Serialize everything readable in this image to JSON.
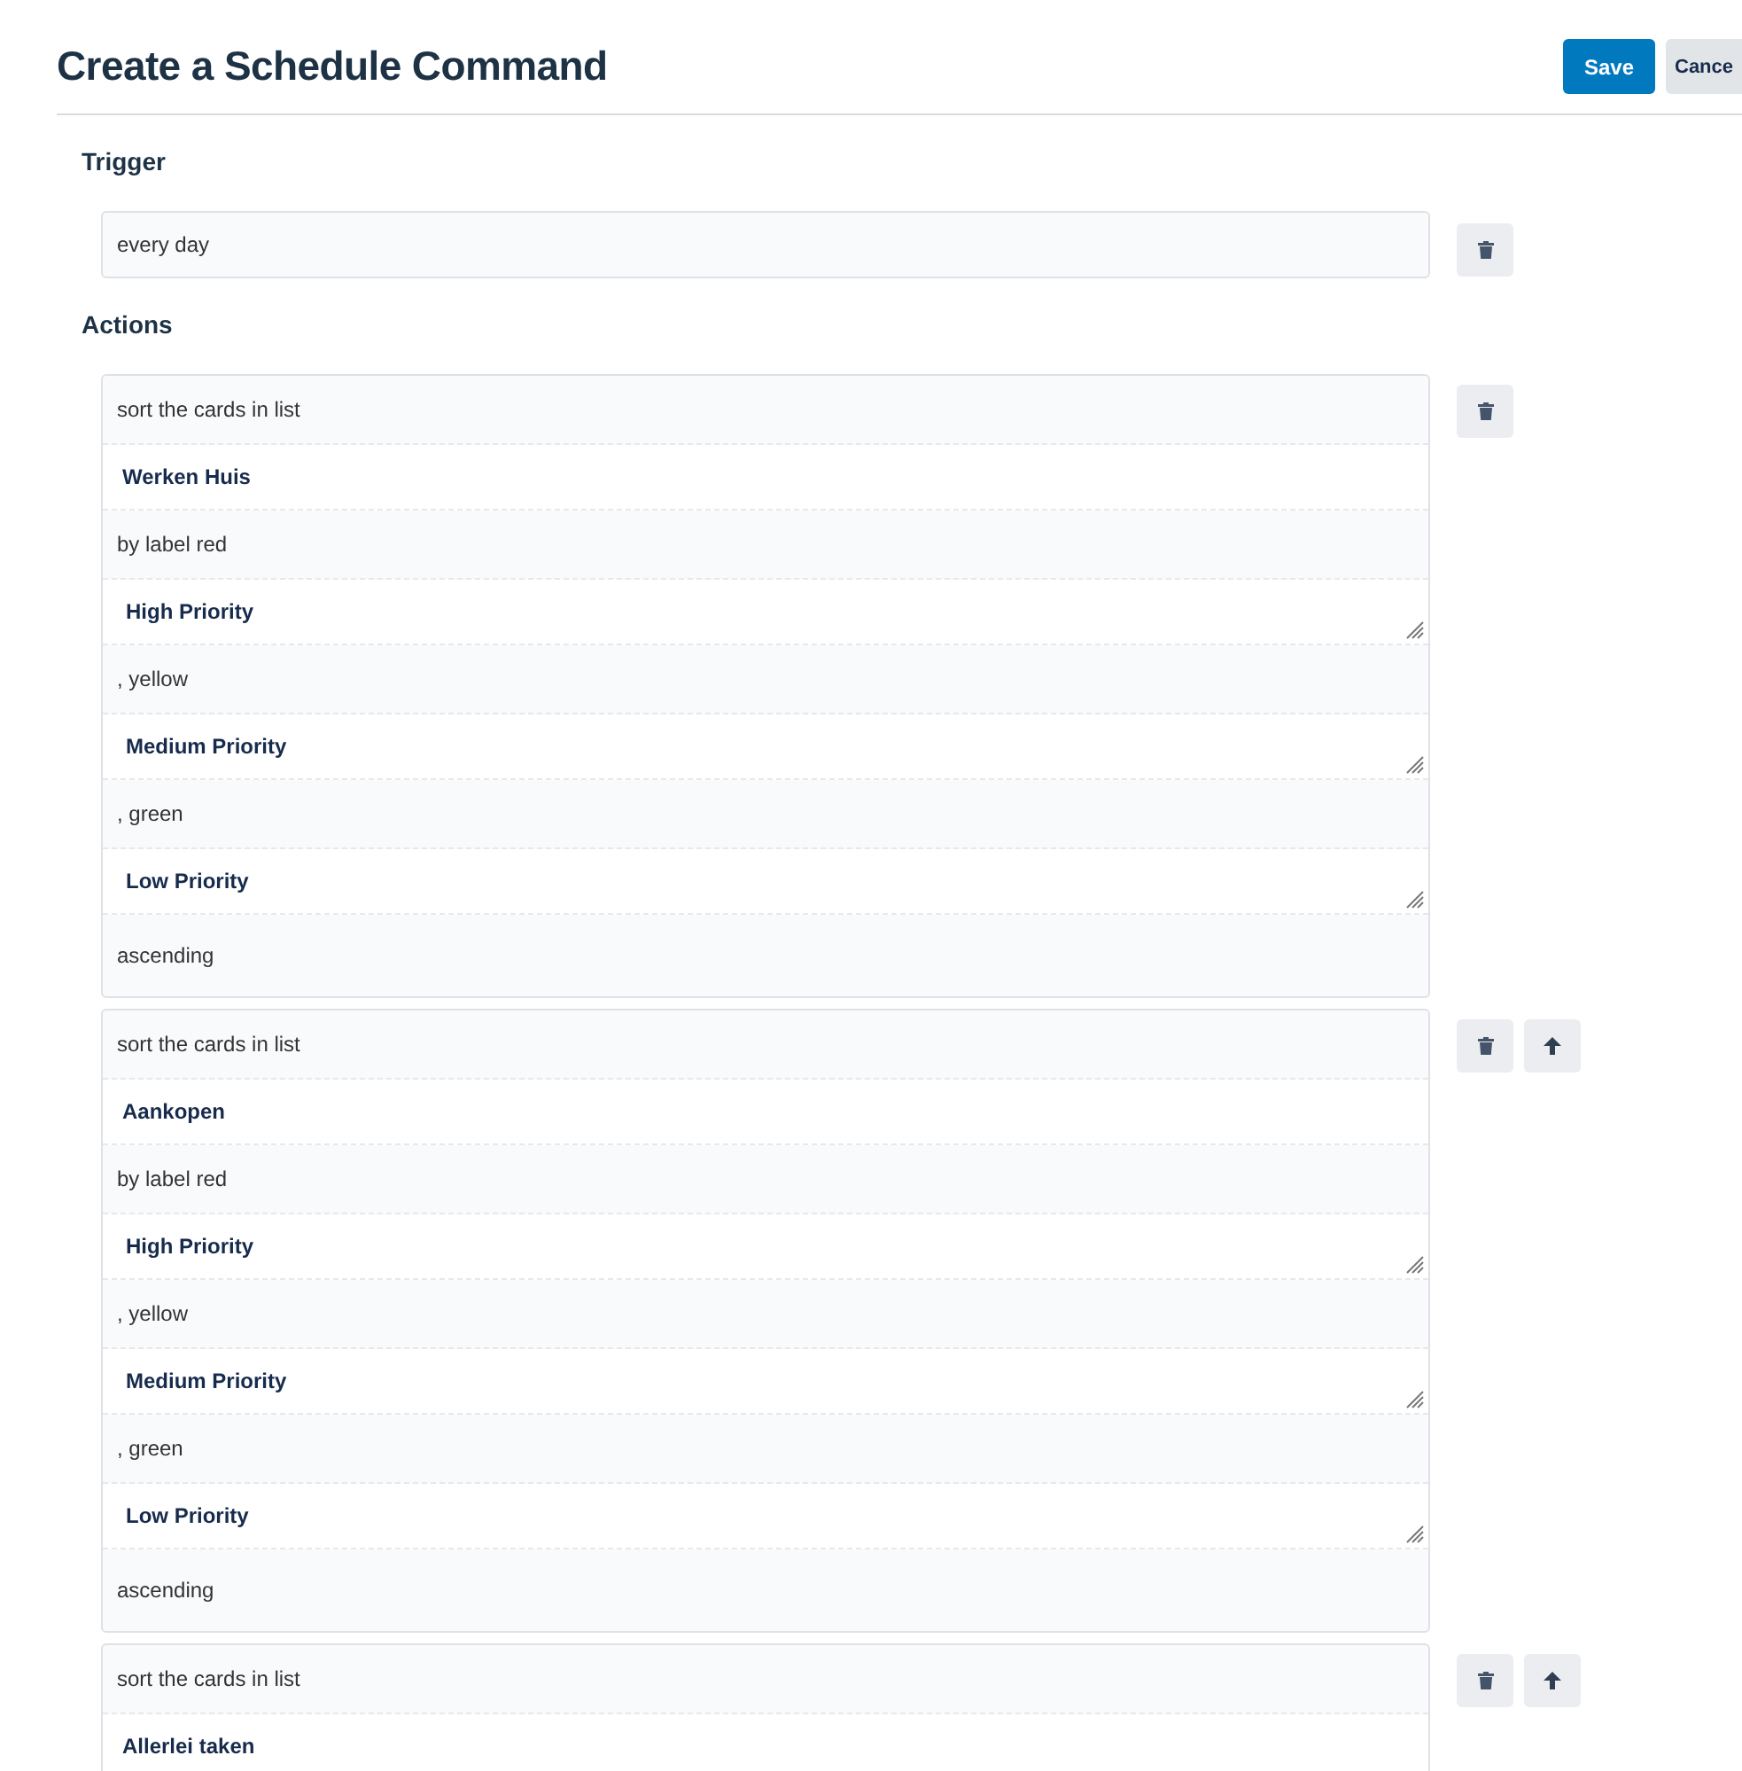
{
  "title": "Create a Schedule Command",
  "header_buttons": [
    {
      "label": "Save",
      "kind": "primary"
    },
    {
      "label": "Cance",
      "kind": "secondary"
    }
  ],
  "trigger": {
    "heading": "Trigger",
    "value": "every day"
  },
  "actions_heading": "Actions",
  "actions": [
    {
      "can_move_up": false,
      "parts": [
        {
          "kind": "text",
          "text": "sort the cards in list"
        },
        {
          "kind": "list",
          "text": "Werken Huis"
        },
        {
          "kind": "text",
          "text": "by label red"
        },
        {
          "kind": "label",
          "text": "High Priority"
        },
        {
          "kind": "text",
          "text": ", yellow"
        },
        {
          "kind": "label",
          "text": "Medium Priority"
        },
        {
          "kind": "text",
          "text": ", green"
        },
        {
          "kind": "label",
          "text": "Low Priority"
        },
        {
          "kind": "end",
          "text": "ascending"
        }
      ]
    },
    {
      "can_move_up": true,
      "parts": [
        {
          "kind": "text",
          "text": "sort the cards in list"
        },
        {
          "kind": "list",
          "text": "Aankopen"
        },
        {
          "kind": "text",
          "text": "by label red"
        },
        {
          "kind": "label",
          "text": "High Priority"
        },
        {
          "kind": "text",
          "text": ", yellow"
        },
        {
          "kind": "label",
          "text": "Medium Priority"
        },
        {
          "kind": "text",
          "text": ", green"
        },
        {
          "kind": "label",
          "text": "Low Priority"
        },
        {
          "kind": "end",
          "text": "ascending"
        }
      ]
    },
    {
      "can_move_up": true,
      "parts": [
        {
          "kind": "text",
          "text": "sort the cards in list"
        },
        {
          "kind": "list",
          "text": "Allerlei taken"
        }
      ]
    }
  ]
}
